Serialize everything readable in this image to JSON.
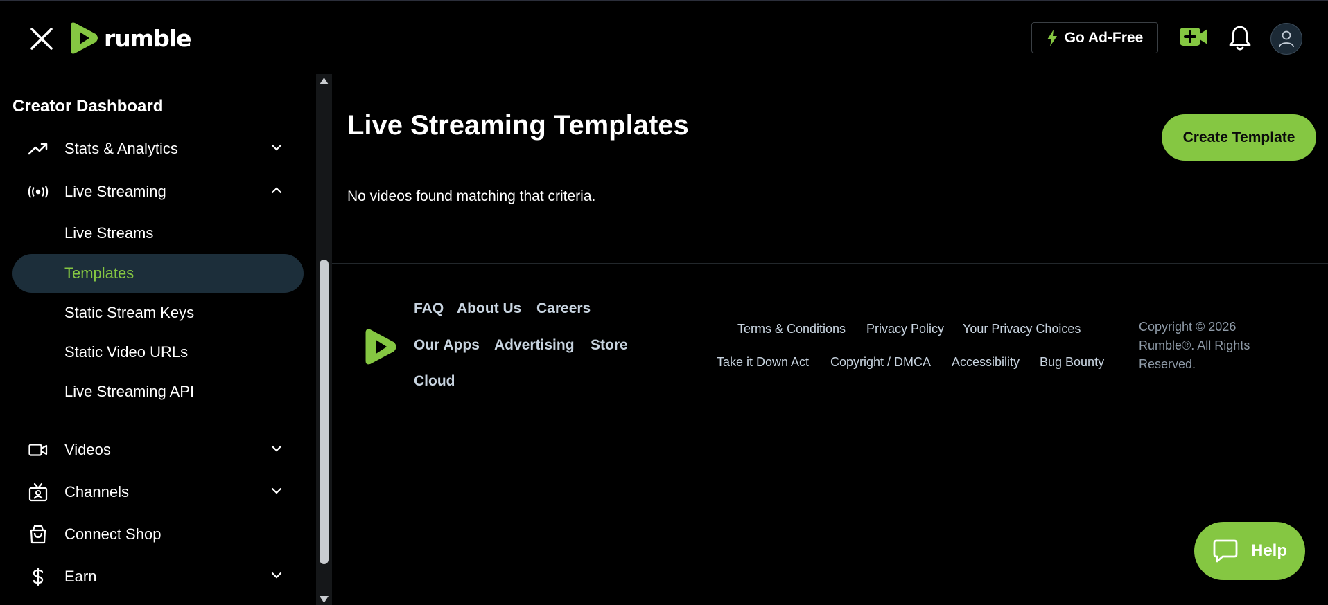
{
  "header": {
    "logo_text": "rumble",
    "go_ad_free_label": "Go Ad-Free",
    "icons": [
      "close-icon",
      "lightning-icon",
      "upload-video-icon",
      "bell-icon",
      "user-icon"
    ]
  },
  "sidebar": {
    "title": "Creator Dashboard",
    "items": [
      {
        "label": "Stats & Analytics",
        "icon": "trending-up-icon",
        "expanded": false
      },
      {
        "label": "Live Streaming",
        "icon": "broadcast-icon",
        "expanded": true
      },
      {
        "label": "Videos",
        "icon": "video-camera-icon",
        "expanded": false
      },
      {
        "label": "Channels",
        "icon": "tv-icon",
        "expanded": false
      },
      {
        "label": "Connect Shop",
        "icon": "shopping-bag-icon"
      },
      {
        "label": "Earn",
        "icon": "dollar-icon",
        "expanded": false
      }
    ],
    "live_streaming_subitems": [
      {
        "label": "Live Streams"
      },
      {
        "label": "Templates",
        "active": true
      },
      {
        "label": "Static Stream Keys"
      },
      {
        "label": "Static Video URLs"
      },
      {
        "label": "Live Streaming API"
      }
    ]
  },
  "main": {
    "title": "Live Streaming Templates",
    "create_button_label": "Create Template",
    "empty_message": "No videos found matching that criteria."
  },
  "footer": {
    "links": [
      "FAQ",
      "About Us",
      "Careers",
      "Our Apps",
      "Advertising",
      "Store",
      "Cloud"
    ],
    "legal_links": [
      "Terms & Conditions",
      "Privacy Policy",
      "Your Privacy Choices",
      "Take it Down Act",
      "Copyright / DMCA",
      "Accessibility",
      "Bug Bounty"
    ],
    "copyright": "Copyright © 2026 Rumble®. All Rights Reserved."
  },
  "help_label": "Help",
  "colors": {
    "accent": "#85c742",
    "active_bg": "#1c2e3a",
    "footer_link": "#c8d4e0",
    "copyright_text": "#8f9ba8"
  }
}
